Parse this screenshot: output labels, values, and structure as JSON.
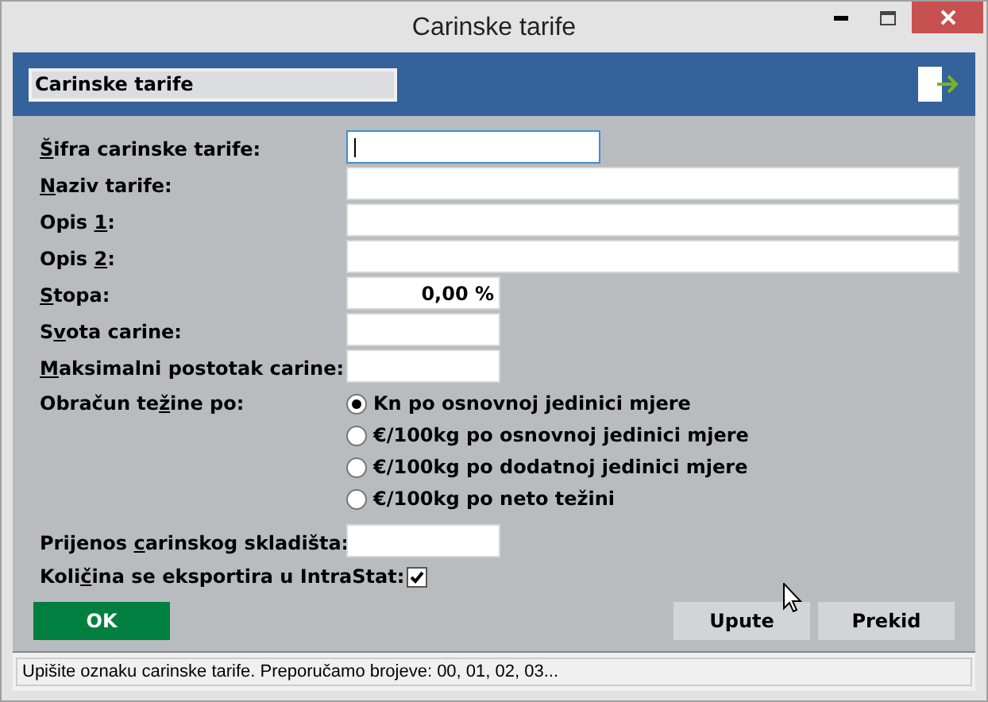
{
  "window": {
    "title": "Carinske tarife"
  },
  "header": {
    "title": "Carinske tarife"
  },
  "fields": [
    {
      "label": {
        "key": "Š",
        "after": "ifra carinske tarife:"
      },
      "kind": "medium",
      "focused": true
    },
    {
      "label": {
        "key": "N",
        "after": "aziv tarife:"
      },
      "kind": "wide",
      "focused": false
    },
    {
      "label": {
        "before": "Opis ",
        "key": "1",
        "after": ":"
      },
      "kind": "wide",
      "focused": false
    },
    {
      "label": {
        "before": "Opis ",
        "key": "2",
        "after": ":"
      },
      "kind": "wide",
      "focused": false
    },
    {
      "label": {
        "key": "S",
        "after": "topa:"
      },
      "value": "0,00 %",
      "kind": "short",
      "focused": false
    },
    {
      "label": {
        "before": "S",
        "key": "v",
        "after": "ota carine:"
      },
      "kind": "short",
      "focused": false
    },
    {
      "label": {
        "key": "M",
        "after": "aksimalni postotak carine:"
      },
      "kind": "short",
      "focused": false
    }
  ],
  "weight_calc": {
    "label": {
      "before": "Obračun te",
      "key": "ž",
      "after": "ine po:"
    },
    "options": [
      {
        "label": "Kn po osnovnoj jedinici mjere",
        "selected": true
      },
      {
        "label": "€/100kg po osnovnoj jedinici mjere",
        "selected": false
      },
      {
        "label": "€/100kg po dodatnoj jedinici mjere",
        "selected": false
      },
      {
        "label": "€/100kg po neto težini",
        "selected": false
      }
    ]
  },
  "warehouse": {
    "label": {
      "before": "Prijenos ",
      "key": "c",
      "after": "arinskog skladišta:"
    }
  },
  "intrastat": {
    "label": {
      "before": "Koli",
      "key": "č",
      "after": "ina se eksportira u IntraStat:"
    },
    "checked": true
  },
  "buttons": {
    "ok": "OK",
    "help": "Upute",
    "cancel": "Prekid"
  },
  "status_bar": "Upišite oznaku carinske tarife. Preporučamo brojeve: 00, 01, 02, 03..."
}
